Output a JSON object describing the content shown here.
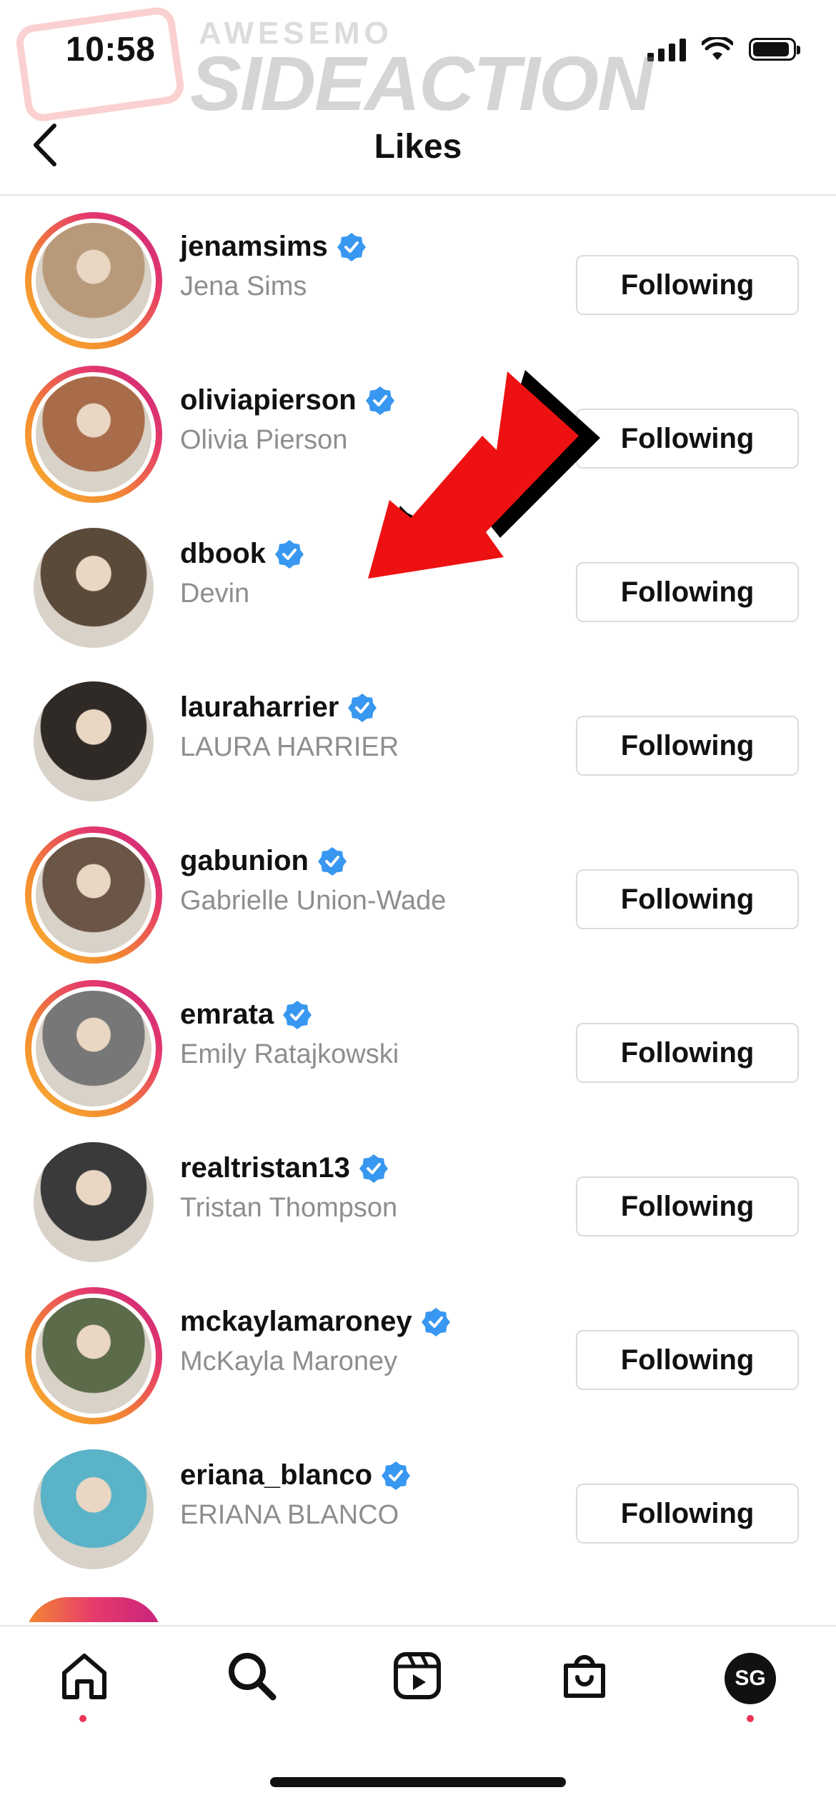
{
  "status_bar": {
    "time": "10:58",
    "icons": [
      "signal-icon",
      "wifi-icon",
      "battery-icon"
    ]
  },
  "watermark": {
    "top_text": "AWESEMO",
    "main_text": "SIDEACTION"
  },
  "header": {
    "title": "Likes",
    "back_icon": "chevron-left-icon"
  },
  "users": [
    {
      "username": "jenamsims",
      "name": "Jena Sims",
      "button": "Following",
      "verified": true,
      "story_ring": true,
      "avatar_color": "#b89a7a"
    },
    {
      "username": "oliviapierson",
      "name": "Olivia Pierson",
      "button": "Following",
      "verified": true,
      "story_ring": true,
      "avatar_color": "#a86c4a"
    },
    {
      "username": "dbook",
      "name": "Devin",
      "button": "Following",
      "verified": true,
      "story_ring": false,
      "avatar_color": "#5a4a3a"
    },
    {
      "username": "lauraharrier",
      "name": "LAURA HARRIER",
      "button": "Following",
      "verified": true,
      "story_ring": false,
      "avatar_color": "#2f2a26"
    },
    {
      "username": "gabunion",
      "name": "Gabrielle Union-Wade",
      "button": "Following",
      "verified": true,
      "story_ring": true,
      "avatar_color": "#6b5546"
    },
    {
      "username": "emrata",
      "name": "Emily Ratajkowski",
      "button": "Following",
      "verified": true,
      "story_ring": true,
      "avatar_color": "#777777"
    },
    {
      "username": "realtristan13",
      "name": "Tristan Thompson",
      "button": "Following",
      "verified": true,
      "story_ring": false,
      "avatar_color": "#3a3a3a"
    },
    {
      "username": "mckaylamaroney",
      "name": "McKayla Maroney",
      "button": "Following",
      "verified": true,
      "story_ring": true,
      "avatar_color": "#5c6b4a"
    },
    {
      "username": "eriana_blanco",
      "name": "ERIANA BLANCO",
      "button": "Following",
      "verified": true,
      "story_ring": false,
      "avatar_color": "#5bb3c7"
    }
  ],
  "tab_bar": {
    "tabs": [
      "home-icon",
      "search-icon",
      "reels-icon",
      "shop-icon"
    ],
    "profile_initials": "SG"
  },
  "colors": {
    "verified": "#3897f0",
    "secondary_text": "#8e8e8e",
    "arrow": "#ee1111",
    "notification_dot": "#ed3358"
  }
}
